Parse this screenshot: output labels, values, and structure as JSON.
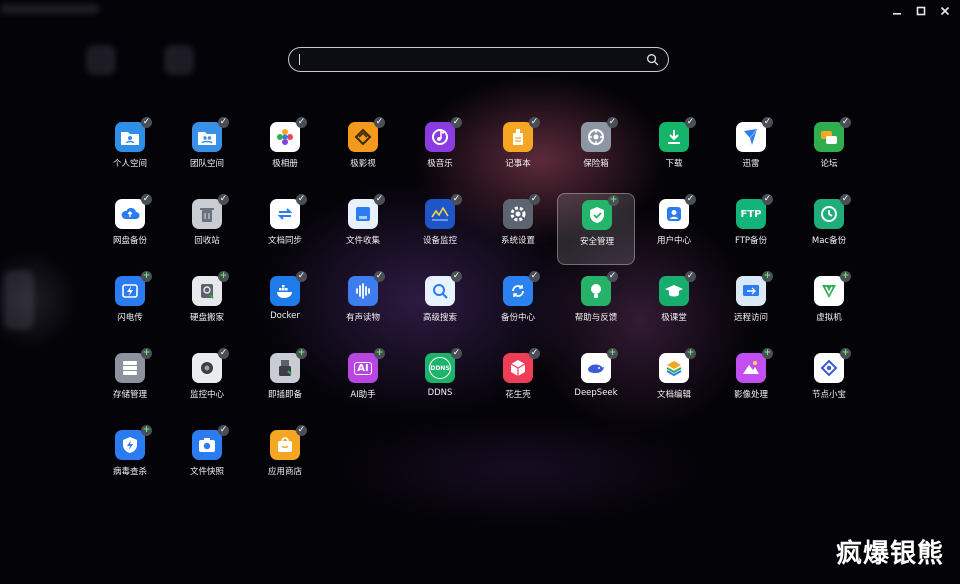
{
  "window": {
    "minimize_icon": "minimize-icon",
    "maximize_icon": "maximize-icon",
    "close_icon": "close-icon"
  },
  "search": {
    "placeholder": "",
    "value": "",
    "icon": "search-icon"
  },
  "apps": [
    {
      "label": "个人空间",
      "icon": "folder-person-icon",
      "color": "#2f8fe8",
      "badge": "pin"
    },
    {
      "label": "团队空间",
      "icon": "folder-team-icon",
      "color": "#3a8fe6",
      "badge": "pin"
    },
    {
      "label": "极相册",
      "icon": "photo-flower-icon",
      "color": "#ffffff",
      "badge": "pin"
    },
    {
      "label": "极影视",
      "icon": "film-icon",
      "color": "#f39a1e",
      "badge": "pin"
    },
    {
      "label": "极音乐",
      "icon": "music-icon",
      "color": "#8a3ce0",
      "badge": "pin"
    },
    {
      "label": "记事本",
      "icon": "notepad-icon",
      "color": "#f5a623",
      "badge": "pin"
    },
    {
      "label": "保险箱",
      "icon": "safe-icon",
      "color": "#8e96a3",
      "badge": "pin"
    },
    {
      "label": "下载",
      "icon": "download-icon",
      "color": "#16b36a",
      "badge": "pin"
    },
    {
      "label": "迅雷",
      "icon": "thunder-icon",
      "color": "#ffffff",
      "badge": "pin"
    },
    {
      "label": "论坛",
      "icon": "forum-icon",
      "color": "#2fae4f",
      "badge": "pin"
    },
    {
      "label": "网盘备份",
      "icon": "cloud-backup-icon",
      "color": "#ffffff",
      "badge": "pin"
    },
    {
      "label": "回收站",
      "icon": "trash-icon",
      "color": "#c9ccd2",
      "badge": "pin"
    },
    {
      "label": "文档同步",
      "icon": "sync-icon",
      "color": "#ffffff",
      "badge": "pin"
    },
    {
      "label": "文件收集",
      "icon": "file-collect-icon",
      "color": "#e7f1ff",
      "badge": "pin"
    },
    {
      "label": "设备监控",
      "icon": "monitor-chart-icon",
      "color": "#1e56c9",
      "badge": "pin"
    },
    {
      "label": "系统设置",
      "icon": "gear-icon",
      "color": "#5b6470",
      "badge": "pin"
    },
    {
      "label": "安全管理",
      "icon": "shield-icon",
      "color": "#24b46a",
      "badge": "add",
      "selected": true
    },
    {
      "label": "用户中心",
      "icon": "user-icon",
      "color": "#ffffff",
      "badge": "pin"
    },
    {
      "label": "FTP备份",
      "icon": "ftp-icon",
      "color": "#13b47a",
      "badge": "pin"
    },
    {
      "label": "Mac备份",
      "icon": "time-machine-icon",
      "color": "#1fae7a",
      "badge": "pin"
    },
    {
      "label": "闪电传",
      "icon": "flash-transfer-icon",
      "color": "#2a7cf0",
      "badge": "add"
    },
    {
      "label": "硬盘搬家",
      "icon": "disk-move-icon",
      "color": "#e6e8ec",
      "badge": "add"
    },
    {
      "label": "Docker",
      "icon": "docker-icon",
      "color": "#1f7be8",
      "badge": "pin"
    },
    {
      "label": "有声读物",
      "icon": "audio-wave-icon",
      "color": "#3d7df0",
      "badge": "pin"
    },
    {
      "label": "高级搜索",
      "icon": "magnifier-icon",
      "color": "#e9f2ff",
      "badge": "pin"
    },
    {
      "label": "备份中心",
      "icon": "backup-center-icon",
      "color": "#2a82f0",
      "badge": "pin"
    },
    {
      "label": "帮助与反馈",
      "icon": "lightbulb-icon",
      "color": "#27b26a",
      "badge": "pin"
    },
    {
      "label": "极课堂",
      "icon": "graduation-cap-icon",
      "color": "#17ad6e",
      "badge": "pin"
    },
    {
      "label": "远程访问",
      "icon": "remote-access-icon",
      "color": "#dbe8f8",
      "badge": "add"
    },
    {
      "label": "虚拟机",
      "icon": "vm-icon",
      "color": "#ffffff",
      "badge": "add"
    },
    {
      "label": "存储管理",
      "icon": "storage-icon",
      "color": "#8c939d",
      "badge": "add"
    },
    {
      "label": "监控中心",
      "icon": "camera-monitor-icon",
      "color": "#eaecef",
      "badge": "pin"
    },
    {
      "label": "即插即备",
      "icon": "usb-backup-icon",
      "color": "#c9ccd2",
      "badge": "add"
    },
    {
      "label": "AI助手",
      "icon": "ai-assistant-icon",
      "color": "#b846e0",
      "badge": "add"
    },
    {
      "label": "DDNS",
      "icon": "ddns-globe-icon",
      "color": "#1db36a",
      "badge": "pin"
    },
    {
      "label": "花生壳",
      "icon": "peanut-cube-icon",
      "color": "#ee3d57",
      "badge": "pin"
    },
    {
      "label": "DeepSeek",
      "icon": "deepseek-whale-icon",
      "color": "#ffffff",
      "badge": "add"
    },
    {
      "label": "文档编辑",
      "icon": "doc-layers-icon",
      "color": "#ffffff",
      "badge": "add"
    },
    {
      "label": "影像处理",
      "icon": "image-process-icon",
      "color": "#c44ff0",
      "badge": "add"
    },
    {
      "label": "节点小宝",
      "icon": "node-icon",
      "color": "#ffffff",
      "badge": "add"
    },
    {
      "label": "病毒查杀",
      "icon": "antivirus-icon",
      "color": "#2a7cf0",
      "badge": "add"
    },
    {
      "label": "文件快照",
      "icon": "snapshot-camera-icon",
      "color": "#2a7cf0",
      "badge": "pin"
    },
    {
      "label": "应用商店",
      "icon": "store-bag-icon",
      "color": "#f5a623",
      "badge": "pin"
    }
  ],
  "ai_icon_text": "AI",
  "ftp_icon_text": "FTP",
  "ddns_icon_text": "DDNS",
  "watermark": "疯爆银熊"
}
